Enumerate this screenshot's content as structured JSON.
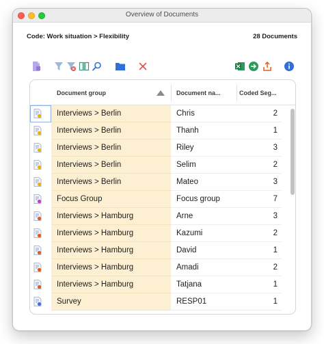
{
  "window": {
    "title": "Overview of Documents"
  },
  "header": {
    "code_label": "Code: Work situation > Flexibility",
    "doc_count": "28 Documents"
  },
  "toolbar": {
    "left_icons": [
      "document-icon",
      "filter-icon",
      "filter-reset-icon",
      "columns-icon",
      "search-icon",
      "folder-icon",
      "delete-icon"
    ],
    "right_icons": [
      "excel-export-icon",
      "web-export-icon",
      "share-export-icon",
      "info-icon"
    ]
  },
  "table": {
    "columns": [
      "Document group",
      "Document na...",
      "Coded Seg..."
    ],
    "rows": [
      {
        "group": "Interviews > Berlin",
        "name": "Chris",
        "count": "2",
        "icon": "interview-berlin-doc-icon",
        "accent": "#e8b400"
      },
      {
        "group": "Interviews > Berlin",
        "name": "Thanh",
        "count": "1",
        "icon": "interview-berlin-doc-icon",
        "accent": "#e8b400"
      },
      {
        "group": "Interviews > Berlin",
        "name": "Riley",
        "count": "3",
        "icon": "interview-berlin-doc-icon",
        "accent": "#e8b400"
      },
      {
        "group": "Interviews > Berlin",
        "name": "Selim",
        "count": "2",
        "icon": "interview-berlin-doc-icon",
        "accent": "#e8b400"
      },
      {
        "group": "Interviews > Berlin",
        "name": "Mateo",
        "count": "3",
        "icon": "interview-berlin-doc-icon",
        "accent": "#e8b400"
      },
      {
        "group": "Focus Group",
        "name": "Focus group",
        "count": "7",
        "icon": "focus-group-doc-icon",
        "accent": "#c040c0"
      },
      {
        "group": "Interviews > Hamburg",
        "name": "Arne",
        "count": "3",
        "icon": "interview-hamburg-doc-icon",
        "accent": "#e85a10"
      },
      {
        "group": "Interviews > Hamburg",
        "name": "Kazumi",
        "count": "2",
        "icon": "interview-hamburg-doc-icon",
        "accent": "#e85a10"
      },
      {
        "group": "Interviews > Hamburg",
        "name": "David",
        "count": "1",
        "icon": "interview-hamburg-doc-icon",
        "accent": "#e85a10"
      },
      {
        "group": "Interviews > Hamburg",
        "name": "Amadi",
        "count": "2",
        "icon": "interview-hamburg-doc-icon",
        "accent": "#e85a10"
      },
      {
        "group": "Interviews > Hamburg",
        "name": "Tatjana",
        "count": "1",
        "icon": "interview-hamburg-doc-icon",
        "accent": "#e85a10"
      },
      {
        "group": "Survey",
        "name": "RESP01",
        "count": "1",
        "icon": "survey-doc-icon",
        "accent": "#4a6fd8"
      }
    ]
  },
  "colors": {
    "group_highlight": "#fdf0d2",
    "toolbar_blue": "#2f6fd6",
    "delete_red": "#e05050",
    "excel_green": "#1d7a45"
  }
}
